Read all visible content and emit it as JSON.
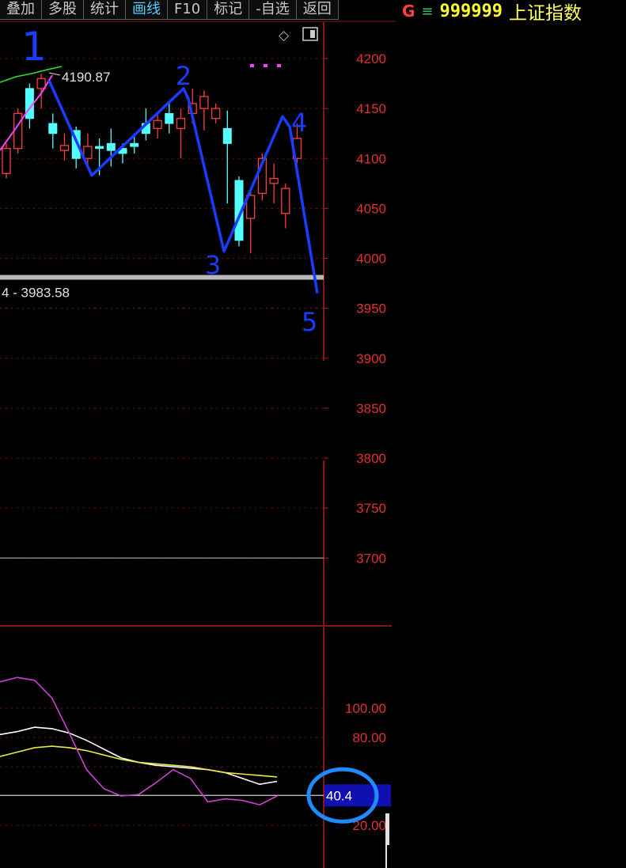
{
  "toolbar": {
    "buttons": [
      {
        "label": "叠加",
        "active": false
      },
      {
        "label": "多股",
        "active": false
      },
      {
        "label": "统计",
        "active": false
      },
      {
        "label": "画线",
        "active": true
      },
      {
        "label": "F10",
        "active": false
      },
      {
        "label": "标记",
        "active": false
      },
      {
        "label": "-自选",
        "active": false
      },
      {
        "label": "返回",
        "active": false
      }
    ]
  },
  "header": {
    "g_label": "G",
    "menu_icon": "menu-icon",
    "code": "999999",
    "name": "上证指数"
  },
  "colors": {
    "up": "#ff3c3c",
    "down": "#54ffff",
    "annotation": "#1a3cff",
    "ma_green": "#30e030",
    "ma_magenta": "#ff40ff",
    "osc_white": "#ffffff",
    "osc_yellow": "#e8e840",
    "osc_magenta": "#d040d0",
    "highlight_circle": "#1e8cff"
  },
  "chart_data": [
    {
      "type": "candlestick",
      "ylim": [
        3650,
        4220
      ],
      "yticks": [
        "4200",
        "4150",
        "4100",
        "4050",
        "4000",
        "3950",
        "3900",
        "3850",
        "3800",
        "3750",
        "3700"
      ],
      "candles": [
        {
          "o": 4085,
          "h": 4115,
          "l": 4080,
          "c": 4110,
          "dir": "up"
        },
        {
          "o": 4110,
          "h": 4150,
          "l": 4105,
          "c": 4145,
          "dir": "up"
        },
        {
          "o": 4140,
          "h": 4175,
          "l": 4130,
          "c": 4170,
          "dir": "down"
        },
        {
          "o": 4170,
          "h": 4185,
          "l": 4150,
          "c": 4180,
          "dir": "up"
        },
        {
          "o": 4135,
          "h": 4145,
          "l": 4110,
          "c": 4125,
          "dir": "down"
        },
        {
          "o": 4108,
          "h": 4125,
          "l": 4098,
          "c": 4113,
          "dir": "up"
        },
        {
          "o": 4128,
          "h": 4132,
          "l": 4090,
          "c": 4100,
          "dir": "down"
        },
        {
          "o": 4112,
          "h": 4125,
          "l": 4090,
          "c": 4100,
          "dir": "up"
        },
        {
          "o": 4112,
          "h": 4120,
          "l": 4083,
          "c": 4110,
          "dir": "down"
        },
        {
          "o": 4108,
          "h": 4130,
          "l": 4092,
          "c": 4115,
          "dir": "down"
        },
        {
          "o": 4105,
          "h": 4115,
          "l": 4095,
          "c": 4110,
          "dir": "down"
        },
        {
          "o": 4115,
          "h": 4125,
          "l": 4105,
          "c": 4112,
          "dir": "down"
        },
        {
          "o": 4125,
          "h": 4150,
          "l": 4118,
          "c": 4135,
          "dir": "down"
        },
        {
          "o": 4130,
          "h": 4145,
          "l": 4120,
          "c": 4138,
          "dir": "up"
        },
        {
          "o": 4135,
          "h": 4155,
          "l": 4125,
          "c": 4145,
          "dir": "down"
        },
        {
          "o": 4130,
          "h": 4150,
          "l": 4100,
          "c": 4140,
          "dir": "up"
        },
        {
          "o": 4145,
          "h": 4170,
          "l": 4135,
          "c": 4155,
          "dir": "up"
        },
        {
          "o": 4150,
          "h": 4168,
          "l": 4128,
          "c": 4162,
          "dir": "up"
        },
        {
          "o": 4150,
          "h": 4155,
          "l": 4135,
          "c": 4140,
          "dir": "up"
        },
        {
          "o": 4130,
          "h": 4148,
          "l": 4055,
          "c": 4115,
          "dir": "down"
        },
        {
          "o": 4078,
          "h": 4082,
          "l": 4012,
          "c": 4018,
          "dir": "down"
        },
        {
          "o": 4040,
          "h": 4068,
          "l": 4005,
          "c": 4063,
          "dir": "up"
        },
        {
          "o": 4065,
          "h": 4105,
          "l": 4058,
          "c": 4100,
          "dir": "up"
        },
        {
          "o": 4075,
          "h": 4095,
          "l": 4055,
          "c": 4080,
          "dir": "up"
        },
        {
          "o": 4045,
          "h": 4075,
          "l": 4030,
          "c": 4070,
          "dir": "up"
        },
        {
          "o": 4100,
          "h": 4135,
          "l": 4095,
          "c": 4120,
          "dir": "up"
        }
      ],
      "annotations": {
        "high_label": "4190.87",
        "low_label": "4 - 3983.58",
        "wave_points": [
          {
            "label": "1",
            "price": 4178
          },
          {
            "label": "2",
            "price": 4170
          },
          {
            "label": "3",
            "price": 4007
          },
          {
            "label": "4",
            "price": 4142
          },
          {
            "label": "5",
            "price": 3965
          }
        ],
        "wave_turn": {
          "price": 4083
        },
        "support_price": 3981,
        "lower_line_price": 3700
      }
    },
    {
      "type": "line",
      "ylim": [
        0,
        130
      ],
      "yticks": [
        "100.00",
        "80.00",
        "40.4",
        "20.00"
      ],
      "current_value": "40.4",
      "series": [
        {
          "color": "white",
          "values": [
            82,
            84,
            87,
            86,
            83,
            78,
            72,
            66,
            63,
            61,
            60,
            59,
            58,
            56,
            52,
            48,
            50
          ]
        },
        {
          "color": "yellow",
          "values": [
            67,
            70,
            73,
            74,
            73,
            71,
            68,
            65,
            63,
            62,
            61,
            60,
            58,
            56,
            55,
            54,
            53
          ]
        },
        {
          "color": "magenta",
          "values": [
            118,
            121,
            119,
            107,
            83,
            58,
            45,
            40,
            41,
            49,
            58,
            52,
            36,
            38,
            37,
            34,
            40
          ]
        }
      ],
      "baseline": 40.4
    }
  ]
}
